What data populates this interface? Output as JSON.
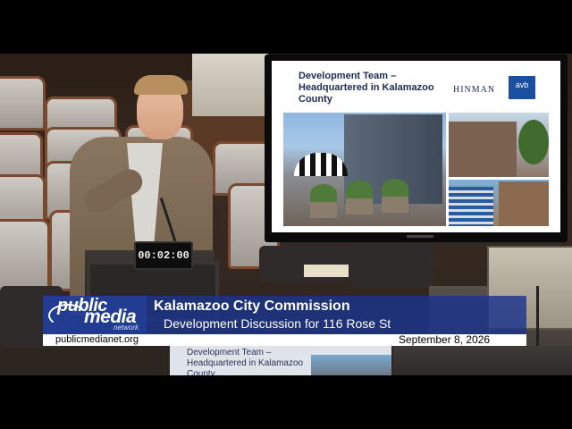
{
  "timer": {
    "value": "00:02:00"
  },
  "slide": {
    "title": "Development Team – Headquartered in Kalamazoo County",
    "logo_hinman": "HINMAN",
    "logo_avb": "avb"
  },
  "lower_third": {
    "logo_public": "public",
    "logo_media": "media",
    "logo_network": "network",
    "title": "Kalamazoo City Commission",
    "subtitle": "Development Discussion for 116 Rose St",
    "url": "publicmedianet.org",
    "date": "September 8, 2026"
  },
  "monitor_bottom": {
    "text": "Development Team – Headquartered in Kalamazoo County"
  },
  "colors": {
    "overlay_blue": "#1c348c",
    "slide_title": "#1d2a55",
    "avb_blue": "#1b4fa0"
  }
}
